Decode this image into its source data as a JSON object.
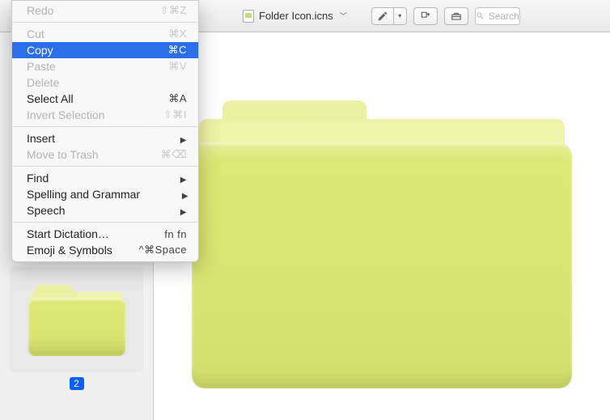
{
  "titlebar": {
    "filename": "Folder Icon.icns",
    "search_placeholder": "Search"
  },
  "sidebar": {
    "thumb_label": "2"
  },
  "menu": {
    "items": [
      {
        "label": "Redo",
        "shortcut": "⇧⌘Z",
        "state": "disabled"
      },
      {
        "sep": true
      },
      {
        "label": "Cut",
        "shortcut": "⌘X",
        "state": "disabled"
      },
      {
        "label": "Copy",
        "shortcut": "⌘C",
        "state": "highlight"
      },
      {
        "label": "Paste",
        "shortcut": "⌘V",
        "state": "disabled"
      },
      {
        "label": "Delete",
        "shortcut": "",
        "state": "disabled"
      },
      {
        "label": "Select All",
        "shortcut": "⌘A",
        "state": ""
      },
      {
        "label": "Invert Selection",
        "shortcut": "⇧⌘I",
        "state": "disabled"
      },
      {
        "sep": true
      },
      {
        "label": "Insert",
        "shortcut": "",
        "state": "",
        "submenu": true
      },
      {
        "label": "Move to Trash",
        "shortcut": "⌘⌫",
        "state": "disabled"
      },
      {
        "sep": true
      },
      {
        "label": "Find",
        "shortcut": "",
        "state": "",
        "submenu": true
      },
      {
        "label": "Spelling and Grammar",
        "shortcut": "",
        "state": "",
        "submenu": true
      },
      {
        "label": "Speech",
        "shortcut": "",
        "state": "",
        "submenu": true
      },
      {
        "sep": true
      },
      {
        "label": "Start Dictation…",
        "shortcut": "fn fn",
        "state": ""
      },
      {
        "label": "Emoji & Symbols",
        "shortcut": "^⌘Space",
        "state": ""
      }
    ]
  }
}
